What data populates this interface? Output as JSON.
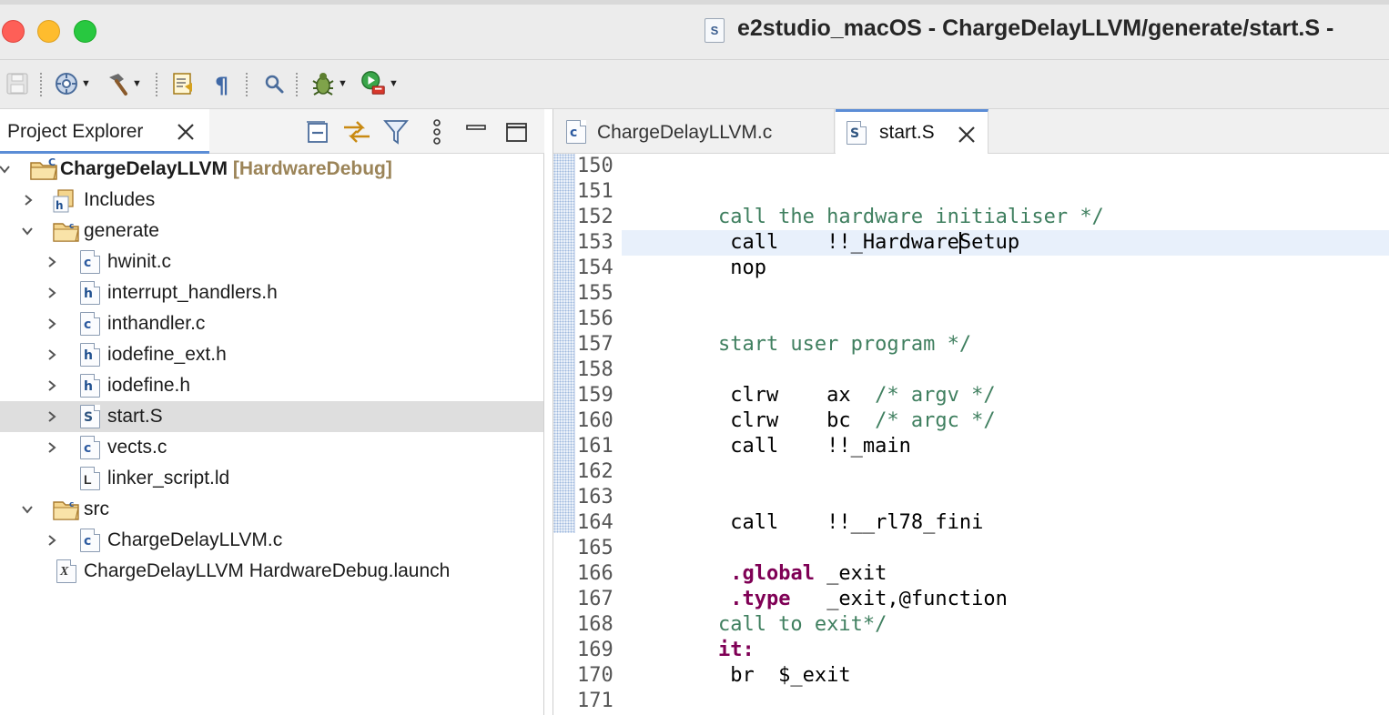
{
  "window": {
    "title": "e2studio_macOS - ChargeDelayLLVM/generate/start.S -",
    "title_icon_letter": "S"
  },
  "toolbar": {
    "items": [
      "save-icon",
      "build-config-icon",
      "hammer-icon",
      "toggle-mark-icon",
      "pilcrow-icon",
      "search-icon",
      "debug-icon",
      "run-icon"
    ]
  },
  "explorer": {
    "tab_label": "Project Explorer",
    "rows": [
      {
        "label": "ChargeDelayLLVM",
        "tag": "[HardwareDebug]"
      },
      {
        "label": "Includes"
      },
      {
        "label": "generate"
      },
      {
        "label": "hwinit.c",
        "icon_letter": "c"
      },
      {
        "label": "interrupt_handlers.h",
        "icon_letter": "h"
      },
      {
        "label": "inthandler.c",
        "icon_letter": "c"
      },
      {
        "label": "iodefine_ext.h",
        "icon_letter": "h"
      },
      {
        "label": "iodefine.h",
        "icon_letter": "h"
      },
      {
        "label": "start.S",
        "icon_letter": "S"
      },
      {
        "label": "vects.c",
        "icon_letter": "c"
      },
      {
        "label": "linker_script.ld",
        "icon_letter": "L"
      },
      {
        "label": "src"
      },
      {
        "label": "ChargeDelayLLVM.c",
        "icon_letter": "c"
      },
      {
        "label": "ChargeDelayLLVM HardwareDebug.launch",
        "icon_letter": "X"
      }
    ],
    "selected_row": "start.S"
  },
  "editor": {
    "tabs": [
      {
        "label": "ChargeDelayLLVM.c",
        "icon_letter": "c",
        "active": false
      },
      {
        "label": "start.S",
        "icon_letter": "S",
        "active": true
      }
    ],
    "line_numbers": [
      "150",
      "151",
      "152",
      "153",
      "154",
      "155",
      "156",
      "157",
      "158",
      "159",
      "160",
      "161",
      "162",
      "163",
      "164",
      "165",
      "166",
      "167",
      "168",
      "169",
      "170",
      "171"
    ],
    "code": [
      {
        "segments": []
      },
      {
        "segments": []
      },
      {
        "segments": [
          {
            "t": "        call the hardware initialiser */",
            "k": "comment"
          }
        ]
      },
      {
        "segments": [
          {
            "t": "         call    !!_HardwareSetup",
            "k": "plain"
          }
        ]
      },
      {
        "segments": [
          {
            "t": "         nop",
            "k": "plain"
          }
        ]
      },
      {
        "segments": []
      },
      {
        "segments": []
      },
      {
        "segments": [
          {
            "t": "        start user program */",
            "k": "comment"
          }
        ]
      },
      {
        "segments": []
      },
      {
        "segments": [
          {
            "t": "         clrw    ax  ",
            "k": "plain"
          },
          {
            "t": "/* argv */",
            "k": "comment"
          }
        ]
      },
      {
        "segments": [
          {
            "t": "         clrw    bc  ",
            "k": "plain"
          },
          {
            "t": "/* argc */",
            "k": "comment"
          }
        ]
      },
      {
        "segments": [
          {
            "t": "         call    !!_main",
            "k": "plain"
          }
        ]
      },
      {
        "segments": []
      },
      {
        "segments": []
      },
      {
        "segments": [
          {
            "t": "         call    !!__rl78_fini",
            "k": "plain"
          }
        ]
      },
      {
        "segments": []
      },
      {
        "segments": [
          {
            "t": "         ",
            "k": "plain"
          },
          {
            "t": ".global",
            "k": "dir"
          },
          {
            "t": " _exit",
            "k": "plain"
          }
        ]
      },
      {
        "segments": [
          {
            "t": "         ",
            "k": "plain"
          },
          {
            "t": ".type",
            "k": "dir"
          },
          {
            "t": "   _exit,@function",
            "k": "plain"
          }
        ]
      },
      {
        "segments": [
          {
            "t": "        call to exit*/",
            "k": "comment"
          }
        ]
      },
      {
        "segments": [
          {
            "t": "        ",
            "k": "plain"
          },
          {
            "t": "it:",
            "k": "label"
          }
        ]
      },
      {
        "segments": [
          {
            "t": "         br  $_exit",
            "k": "plain"
          }
        ]
      },
      {
        "segments": []
      }
    ],
    "current_line": "153"
  },
  "colors": {
    "accent": "#5b8dd6",
    "comment": "#3f7f5f",
    "keyword": "#7f0055",
    "project_tag": "#9b8458",
    "selection": "#dedede",
    "current_line": "#e8f0fb"
  }
}
